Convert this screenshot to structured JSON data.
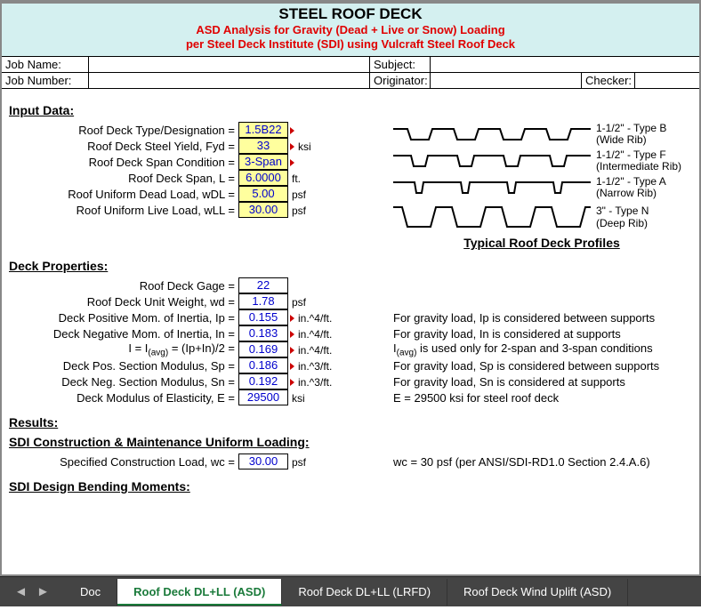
{
  "header": {
    "title": "STEEL ROOF DECK",
    "line1": "ASD Analysis for Gravity (Dead + Live or Snow) Loading",
    "line2": "per Steel Deck Institute (SDI) using Vulcraft Steel Roof Deck"
  },
  "job": {
    "name_lbl": "Job Name:",
    "number_lbl": "Job Number:",
    "subject_lbl": "Subject:",
    "originator_lbl": "Originator:",
    "checker_lbl": "Checker:"
  },
  "sections": {
    "input": "Input Data:",
    "deck_props": "Deck Properties:",
    "results": "Results:",
    "sdi_constr": "SDI Construction & Maintenance Uniform Loading:",
    "sdi_bend": "SDI Design Bending Moments:"
  },
  "inputs": [
    {
      "label": "Roof Deck Type/Designation =",
      "value": "1.5B22",
      "unit": ""
    },
    {
      "label": "Roof Deck Steel Yield, Fyd =",
      "value": "33",
      "unit": "ksi"
    },
    {
      "label": "Roof Deck Span Condition =",
      "value": "3-Span",
      "unit": ""
    },
    {
      "label": "Roof Deck Span, L =",
      "value": "6.0000",
      "unit": "ft."
    },
    {
      "label": "Roof Uniform Dead Load, wDL =",
      "value": "5.00",
      "unit": "psf"
    },
    {
      "label": "Roof Uniform Live Load, wLL =",
      "value": "30.00",
      "unit": "psf"
    }
  ],
  "props": [
    {
      "label": "Roof Deck Gage =",
      "value": "22",
      "unit": "",
      "note": ""
    },
    {
      "label": "Roof Deck Unit Weight, wd =",
      "value": "1.78",
      "unit": "psf",
      "note": ""
    },
    {
      "label": "Deck Positive Mom. of Inertia, Ip =",
      "value": "0.155",
      "unit": "in.^4/ft.",
      "note": "For gravity load, Ip is considered between supports"
    },
    {
      "label": "Deck Negative Mom. of Inertia, In =",
      "value": "0.183",
      "unit": "in.^4/ft.",
      "note": "For gravity load, In is considered at supports"
    },
    {
      "label": "I = I(avg) = (Ip+In)/2 =",
      "value": "0.169",
      "unit": "in.^4/ft.",
      "note": "I(avg) is used only for 2-span and 3-span conditions"
    },
    {
      "label": "Deck Pos. Section Modulus, Sp =",
      "value": "0.186",
      "unit": "in.^3/ft.",
      "note": "For gravity load, Sp is considered between supports"
    },
    {
      "label": "Deck Neg. Section Modulus, Sn =",
      "value": "0.192",
      "unit": "in.^3/ft.",
      "note": "For gravity load, Sn is considered at supports"
    },
    {
      "label": "Deck Modulus of Elasticity, E =",
      "value": "29500",
      "unit": "ksi",
      "note": "E = 29500 ksi for steel roof deck"
    }
  ],
  "constr": {
    "label": "Specified Construction Load, wc =",
    "value": "30.00",
    "unit": "psf",
    "note": "wc = 30 psf (per ANSI/SDI-RD1.0 Section 2.4.A.6)"
  },
  "profiles": {
    "title": "Typical Roof Deck Profiles",
    "items": [
      {
        "line1": "1-1/2\" - Type B",
        "line2": "(Wide Rib)"
      },
      {
        "line1": "1-1/2\" - Type F",
        "line2": "(Intermediate Rib)"
      },
      {
        "line1": "1-1/2\" - Type A",
        "line2": "(Narrow Rib)"
      },
      {
        "line1": "3\" - Type N",
        "line2": "(Deep Rib)"
      }
    ]
  },
  "tabs": {
    "items": [
      "Doc",
      "Roof Deck DL+LL (ASD)",
      "Roof Deck DL+LL (LRFD)",
      "Roof Deck Wind Uplift (ASD)"
    ],
    "active": 1
  }
}
